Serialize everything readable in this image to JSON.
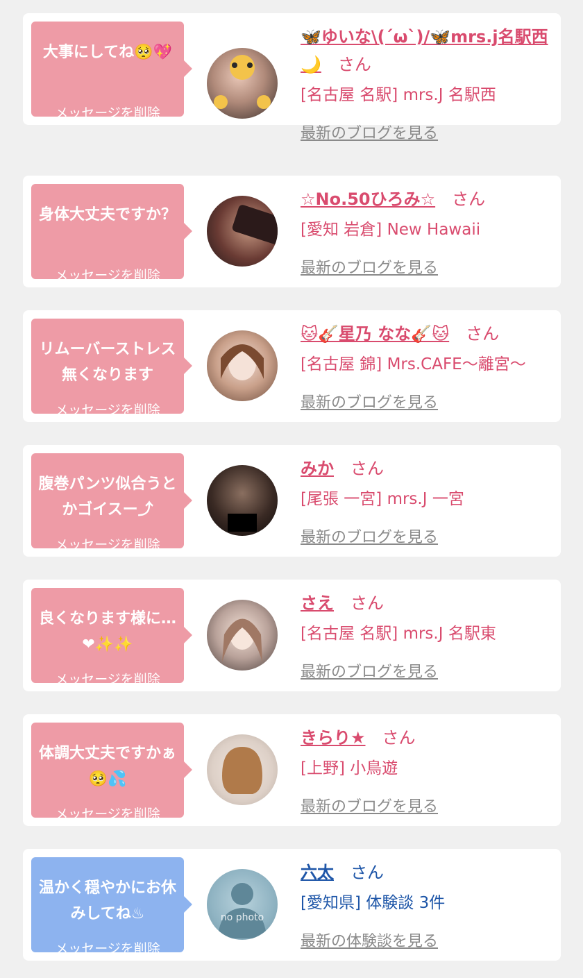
{
  "colors": {
    "background": "#f0f0f0",
    "card": "#ffffff",
    "bubble_pink": "#ee9ba6",
    "bubble_blue": "#8db3ef",
    "name_pink": "#d94b6e",
    "name_blue": "#1e56a8",
    "link_gray": "#8a8a8a"
  },
  "delete_label": "メッセージを削除",
  "san": "さん",
  "items": [
    {
      "message": "大事にしてね🥺💖",
      "name": "🦋ゆいな\\(´ω`)/🦋mrs.j名駅西🌙",
      "shop": "[名古屋 名駅] mrs.J 名駅西",
      "link": "最新のブログを見る",
      "avatar": "avatar-photo"
    },
    {
      "message": "身体大丈夫ですか？",
      "name": "☆No.50ひろみ☆",
      "shop": "[愛知 岩倉] New Hawaii",
      "link": "最新のブログを見る",
      "avatar": "avatar-photo"
    },
    {
      "message": "リムーバーストレス無くなります",
      "name": "🐱🎸星乃 なな🎸🐱",
      "shop": "[名古屋 錦] Mrs.CAFE〜離宮〜",
      "link": "最新のブログを見る",
      "avatar": "avatar-photo"
    },
    {
      "message": "腹巻パンツ似合うとかゴイスー⤴",
      "name": "みか",
      "shop": "[尾張 一宮] mrs.J 一宮",
      "link": "最新のブログを見る",
      "avatar": "avatar-photo"
    },
    {
      "message": "良くなります様に…❤✨✨",
      "name": "さえ",
      "shop": "[名古屋 名駅] mrs.J 名駅東",
      "link": "最新のブログを見る",
      "avatar": "avatar-photo"
    },
    {
      "message": "体調大丈夫ですかぁ🥺💦",
      "name": "きらり★",
      "shop": "[上野] 小鳥遊",
      "link": "最新のブログを見る",
      "avatar": "avatar-photo"
    },
    {
      "message": "温かく穏やかにお休みしてね♨",
      "name": "六太",
      "shop": "[愛知県] 体験談 3件",
      "link": "最新の体験談を見る",
      "avatar": "no-photo-avatar",
      "avatar_text": "no photo"
    }
  ]
}
